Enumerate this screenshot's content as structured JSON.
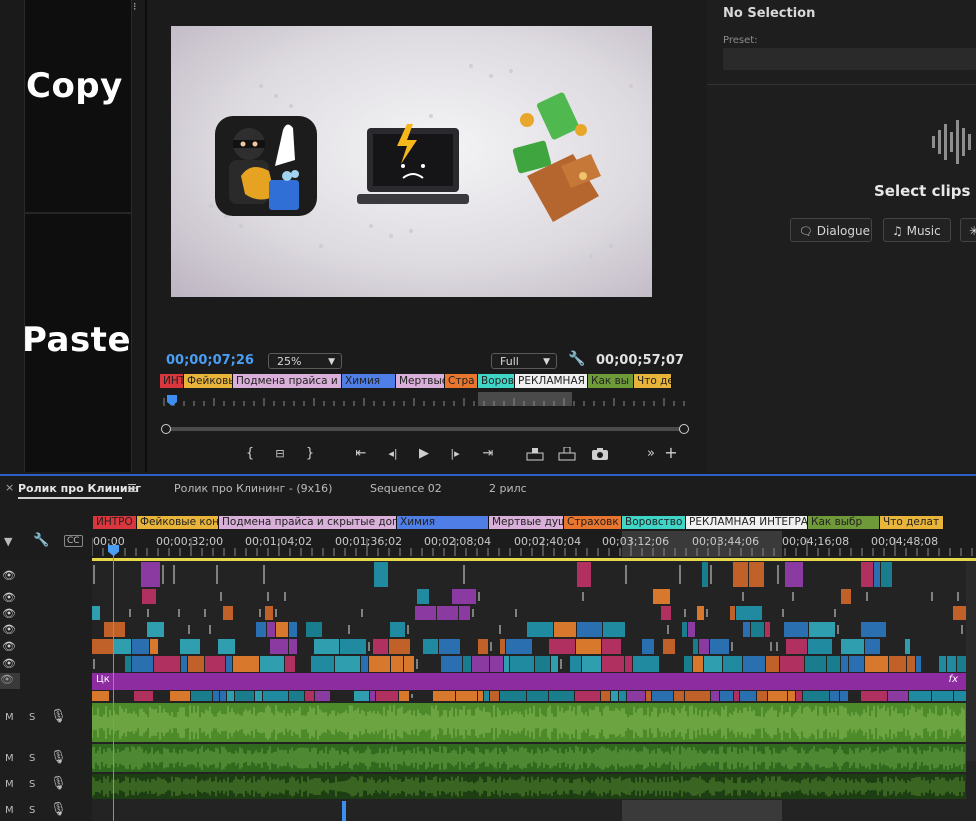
{
  "overlay_text": {
    "copy": "Copy",
    "paste": "Paste"
  },
  "program_monitor": {
    "current_timecode": "00;00;07;26",
    "duration_timecode": "00;00;57;07",
    "zoom": "25%",
    "resolution": "Full",
    "markers": [
      {
        "label": "ИНТРО",
        "color": "#d9363e"
      },
      {
        "label": "Фейковые",
        "color": "#e8b43a"
      },
      {
        "label": "Подмена прайса и",
        "color": "#d9b0d9"
      },
      {
        "label": "Химия",
        "color": "#4f7fe6"
      },
      {
        "label": "Мертвые",
        "color": "#d9b0d9"
      },
      {
        "label": "Стра",
        "color": "#e8762e"
      },
      {
        "label": "Ворово",
        "color": "#3fd6c8"
      },
      {
        "label": "РЕКЛАМНАЯ",
        "color": "#f0f0f0"
      },
      {
        "label": "Как вы",
        "color": "#6f9a3a"
      },
      {
        "label": "Что де",
        "color": "#e8b43a"
      }
    ],
    "controls": [
      "{",
      "⊟",
      "}",
      "⇤",
      "◂|",
      "▶",
      "|▸",
      "⇥",
      "insert",
      "overwrite",
      "camera",
      "»",
      "+"
    ]
  },
  "essential_sound": {
    "title": "No Selection",
    "preset_label": "Preset:",
    "prompt": "Select clips w",
    "types": [
      {
        "label": "Dialogue",
        "icon": "dialogue-icon"
      },
      {
        "label": "Music",
        "icon": "music-icon"
      },
      {
        "label": "",
        "icon": "sfx-icon"
      }
    ]
  },
  "timeline": {
    "tabs": [
      {
        "label": "Ролик про Клининг",
        "active": true
      },
      {
        "label": "Ролик про Клининг - (9x16)",
        "active": false
      },
      {
        "label": "Sequence 02",
        "active": false
      },
      {
        "label": "2 рилс",
        "active": false
      }
    ],
    "markers": [
      {
        "label": "ИНТРО",
        "color": "#d9363e"
      },
      {
        "label": "Фейковые кон",
        "color": "#e8b43a"
      },
      {
        "label": "Подмена прайса и скрытые допл",
        "color": "#d9b0d9"
      },
      {
        "label": "Химия",
        "color": "#4f7fe6"
      },
      {
        "label": "Мертвые душ",
        "color": "#d9b0d9"
      },
      {
        "label": "Страховк",
        "color": "#e8762e"
      },
      {
        "label": "Воровство",
        "color": "#3fd6c8"
      },
      {
        "label": "РЕКЛАМНАЯ ИНТЕГРА",
        "color": "#f0f0f0"
      },
      {
        "label": "Как выбр",
        "color": "#6f9a3a"
      },
      {
        "label": "Что делат",
        "color": "#e8b43a"
      }
    ],
    "ruler": [
      "00;00",
      "00;00;32;00",
      "00;01;04;02",
      "00;01;36;02",
      "00;02;08;04",
      "00;02;40;04",
      "00;03;12;06",
      "00;03;44;06",
      "00;04;16;08",
      "00;04;48;08"
    ],
    "adjustment_clip": {
      "label": "Цк",
      "fx": "fx"
    },
    "audio_track_controls": {
      "mute": "M",
      "solo": "S"
    }
  }
}
